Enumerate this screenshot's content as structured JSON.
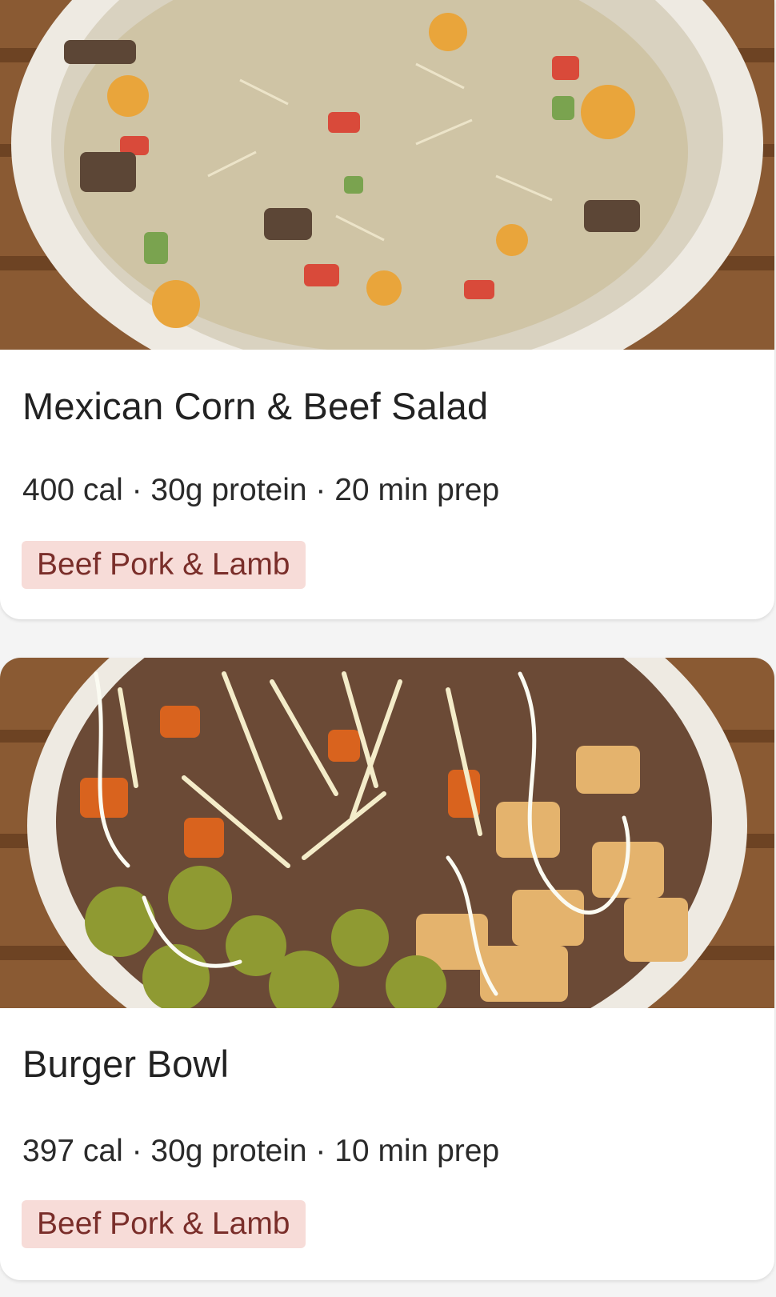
{
  "recipes": [
    {
      "title": "Mexican Corn & Beef Salad",
      "meta": "400 cal · 30g protein · 20 min prep",
      "tag": "Beef Pork & Lamb",
      "image_alt": "bowl of creamy corn, pepper and beef salad topped with grated cheese"
    },
    {
      "title": "Burger Bowl",
      "meta": "397 cal · 30g protein · 10 min prep",
      "tag": "Beef Pork & Lamb",
      "image_alt": "bowl of roast potatoes, ground beef, peppers, pickles, cheese and sauce"
    }
  ],
  "colors": {
    "tag_background": "#f7dcd8",
    "tag_text": "#7a2e2a",
    "card_background": "#ffffff",
    "page_background": "#f4f4f4"
  }
}
